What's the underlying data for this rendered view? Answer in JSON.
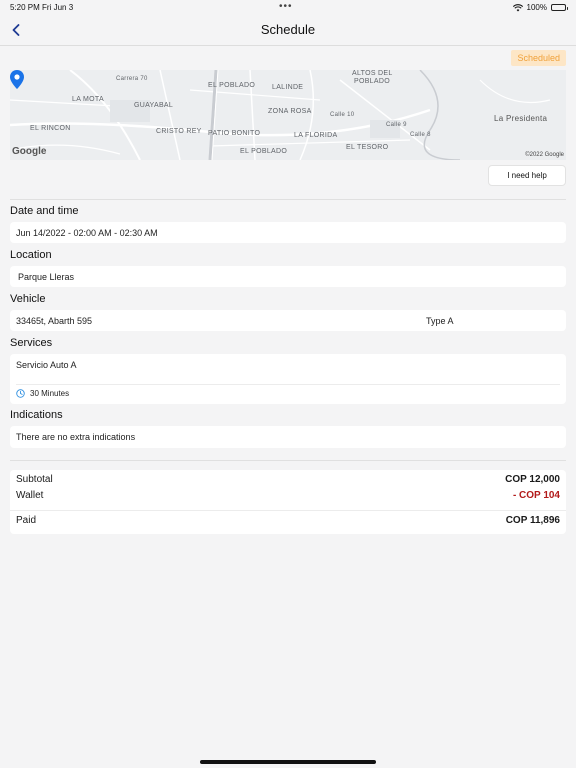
{
  "status_bar": {
    "time": "5:20 PM  Fri Jun 3",
    "battery": "100%"
  },
  "nav": {
    "title": "Schedule"
  },
  "badge": "Scheduled",
  "map": {
    "labels": [
      "ALTOS DEL",
      "POBLADO",
      "EL POBLADO",
      "LALINDE",
      "LA MOTA",
      "GUAYABAL",
      "ZONA ROSA",
      "La Presidenta",
      "EL RINCON",
      "CRISTO REY",
      "PATIO BONITO",
      "LA FLORIDA",
      "EL TESORO",
      "EL POBLADO",
      "Calle 10",
      "Calle 9",
      "Calle 8",
      "Carrera 70"
    ],
    "google": "Google",
    "copyright": "©2022 Google"
  },
  "help_button": "I need help",
  "sections": {
    "date": {
      "title": "Date and time",
      "value": "Jun 14/2022 - 02:00 AM - 02:30 AM"
    },
    "location": {
      "title": "Location",
      "value": "Parque Lleras"
    },
    "vehicle": {
      "title": "Vehicle",
      "value": "33465t, Abarth 595",
      "type": "Type A"
    },
    "services": {
      "title": "Services",
      "value": "Servicio Auto A",
      "duration": "30 Minutes"
    },
    "indications": {
      "title": "Indications",
      "value": "There are no extra indications"
    }
  },
  "summary": {
    "subtotal_label": "Subtotal",
    "subtotal": "COP 12,000",
    "wallet_label": "Wallet",
    "wallet": "- COP 104",
    "paid_label": "Paid",
    "paid": "COP 11,896"
  },
  "colors": {
    "badge_bg": "#fde6c6",
    "badge_text": "#f0a13a",
    "pin": "#1a73e8",
    "negative": "#b21a1a",
    "clock": "#2f8fe0"
  }
}
